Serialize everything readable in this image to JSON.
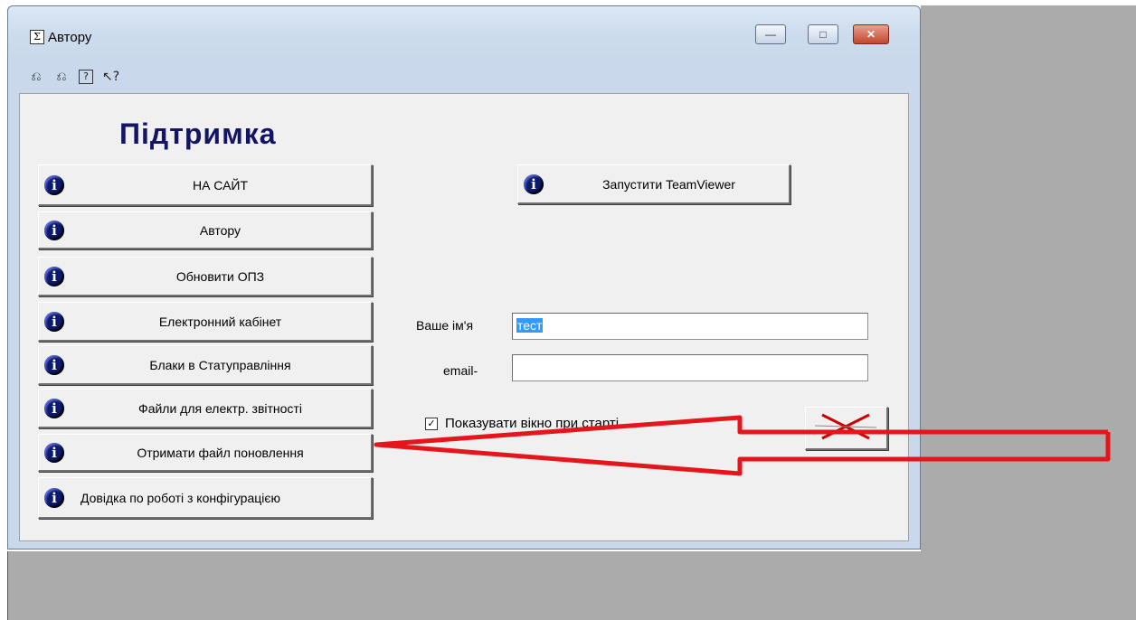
{
  "window": {
    "title": "Автору",
    "app_icon_glyph": "Σ",
    "minimize_glyph": "—",
    "maximize_glyph": "□",
    "close_glyph": "✕"
  },
  "toolbar": [
    {
      "name": "undo-icon",
      "glyph": "⎌"
    },
    {
      "name": "redo-icon",
      "glyph": "⎌"
    },
    {
      "name": "help-icon",
      "glyph": "?"
    },
    {
      "name": "context-help-icon",
      "glyph": "↖?"
    }
  ],
  "heading": "Підтримка",
  "info_glyph": "i",
  "left_buttons": [
    "НА САЙТ",
    "Автору",
    "Обновити ОПЗ",
    "Електронний кабінет",
    "Блаки в Статуправління",
    "Файли для електр. звітності",
    "Отримати файл поновлення",
    "Довідка по роботі з конфігурацією"
  ],
  "teamviewer_button": "Запустити TeamViewer",
  "form": {
    "name_label": "Ваше ім'я",
    "name_value": "тест",
    "email_label": "email-",
    "email_value": ""
  },
  "checkbox": {
    "label": "Показувати вікно при старті",
    "checked_glyph": "✓"
  },
  "colors": {
    "heading": "#141464",
    "info_icon": "#0c1a6e",
    "annotation_arrow": "#e4161b",
    "selection": "#3399ff"
  }
}
